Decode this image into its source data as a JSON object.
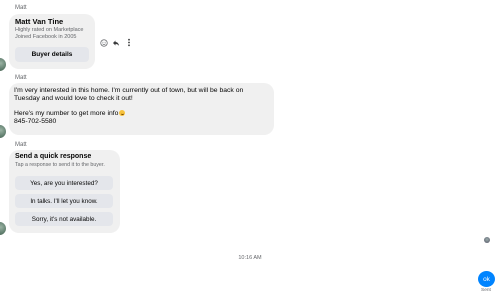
{
  "conversation": {
    "listing_card": {
      "sender": "Matt",
      "name": "Matt Van Tine",
      "rating": "Highly rated on Marketplace",
      "joined": "Joined Facebook in 2005",
      "button_label": "Buyer details",
      "icons": [
        "smiley-icon",
        "reply-icon",
        "more-icon"
      ]
    },
    "message": {
      "sender": "Matt",
      "lines": [
        "I'm very interested in this home. I'm currently out of town, but will be back on",
        "Tuesday and would love to check it out!",
        "Here's my number to get more info",
        "845-702-5580"
      ],
      "emoji": "smiling-face-emoji"
    },
    "quick_response": {
      "sender": "Matt",
      "title": "Send a quick response",
      "subtitle": "Tap a response to send it to the buyer.",
      "options": [
        "Yes, are you interested?",
        "In talks. I'll let you know.",
        "Sorry, it's not available."
      ]
    },
    "timestamp": "10:16 AM",
    "outgoing": {
      "text": "ok",
      "status": "Sent",
      "color": "#0084ff"
    }
  }
}
